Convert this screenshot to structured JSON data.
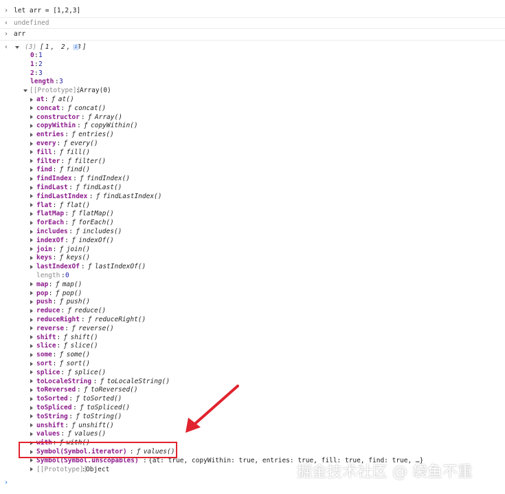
{
  "console": {
    "input1": "let arr = [1,2,3]",
    "output1": "undefined",
    "input2": "arr",
    "result_preview": {
      "count": "(3)",
      "values": "[1, 2, 3]",
      "badge": "i"
    },
    "entries": [
      {
        "key": "0",
        "value": "1"
      },
      {
        "key": "1",
        "value": "2"
      },
      {
        "key": "2",
        "value": "3"
      }
    ],
    "length_label": "length",
    "length_value": "3",
    "prototype_label": "[[Prototype]]",
    "prototype_value": "Array(0)",
    "methods": [
      {
        "name": "at",
        "fn": "at()"
      },
      {
        "name": "concat",
        "fn": "concat()"
      },
      {
        "name": "constructor",
        "fn": "Array()"
      },
      {
        "name": "copyWithin",
        "fn": "copyWithin()"
      },
      {
        "name": "entries",
        "fn": "entries()"
      },
      {
        "name": "every",
        "fn": "every()"
      },
      {
        "name": "fill",
        "fn": "fill()"
      },
      {
        "name": "filter",
        "fn": "filter()"
      },
      {
        "name": "find",
        "fn": "find()"
      },
      {
        "name": "findIndex",
        "fn": "findIndex()"
      },
      {
        "name": "findLast",
        "fn": "findLast()"
      },
      {
        "name": "findLastIndex",
        "fn": "findLastIndex()"
      },
      {
        "name": "flat",
        "fn": "flat()"
      },
      {
        "name": "flatMap",
        "fn": "flatMap()"
      },
      {
        "name": "forEach",
        "fn": "forEach()"
      },
      {
        "name": "includes",
        "fn": "includes()"
      },
      {
        "name": "indexOf",
        "fn": "indexOf()"
      },
      {
        "name": "join",
        "fn": "join()"
      },
      {
        "name": "keys",
        "fn": "keys()"
      },
      {
        "name": "lastIndexOf",
        "fn": "lastIndexOf()"
      }
    ],
    "proto_length_label": "length",
    "proto_length_value": "0",
    "methods2": [
      {
        "name": "map",
        "fn": "map()"
      },
      {
        "name": "pop",
        "fn": "pop()"
      },
      {
        "name": "push",
        "fn": "push()"
      },
      {
        "name": "reduce",
        "fn": "reduce()"
      },
      {
        "name": "reduceRight",
        "fn": "reduceRight()"
      },
      {
        "name": "reverse",
        "fn": "reverse()"
      },
      {
        "name": "shift",
        "fn": "shift()"
      },
      {
        "name": "slice",
        "fn": "slice()"
      },
      {
        "name": "some",
        "fn": "some()"
      },
      {
        "name": "sort",
        "fn": "sort()"
      },
      {
        "name": "splice",
        "fn": "splice()"
      },
      {
        "name": "toLocaleString",
        "fn": "toLocaleString()"
      },
      {
        "name": "toReversed",
        "fn": "toReversed()"
      },
      {
        "name": "toSorted",
        "fn": "toSorted()"
      },
      {
        "name": "toSpliced",
        "fn": "toSpliced()"
      },
      {
        "name": "toString",
        "fn": "toString()"
      },
      {
        "name": "unshift",
        "fn": "unshift()"
      },
      {
        "name": "values",
        "fn": "values()"
      },
      {
        "name": "with",
        "fn": "with()"
      },
      {
        "name": "Symbol(Symbol.iterator)",
        "fn": "values()"
      }
    ],
    "unscopables_label": "Symbol(Symbol.unscopables)",
    "unscopables_value": "{at: true, copyWithin: true, entries: true, fill: true, find: true, …}",
    "object_proto_label": "[[Prototype]]",
    "object_proto_value": "Object",
    "f_glyph": "ƒ",
    "gutter_input": "›",
    "gutter_output": "‹"
  },
  "watermark": "掘金技术社区 @ 袋鱼不重",
  "annotation_color": "#e0232e"
}
